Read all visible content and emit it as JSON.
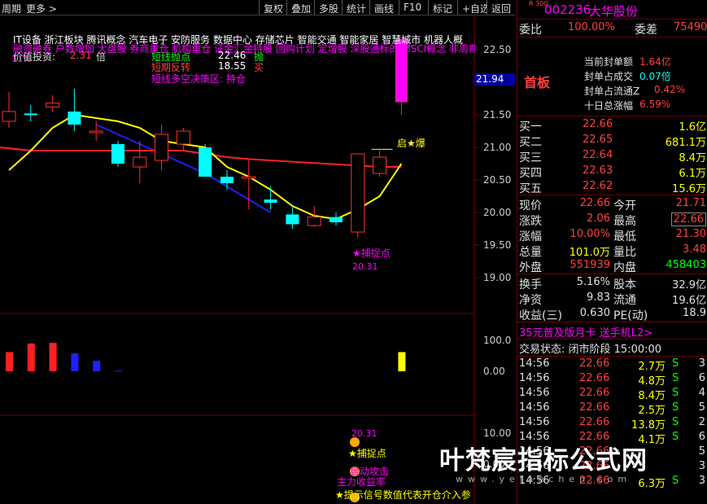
{
  "topbar": {
    "period_label": "周期",
    "more_label": "更多 >",
    "buttons": [
      "复权",
      "叠加",
      "多股",
      "统计",
      "画线",
      "F10",
      "标记",
      "+自选",
      "返回"
    ]
  },
  "chart": {
    "sectors_line1": "IT设备  浙江板块  腾讯概念 汽车电子 安防服务 数据中心 存储芯片 智能交通 智能家居 智慧城市 机器人概",
    "sectors_line2": "融资融券 户数增加 大盘股 券商重仓 机构重仓 证金汇金持股 回购计划 定增股 深股通标的 MSCI概念 非周期",
    "tag_11": "11%",
    "value_invest_label": "价值投资:",
    "value_invest_value": "2.31",
    "value_invest_unit": "倍",
    "indicators": [
      {
        "label": "短线抛点",
        "value": "22.46",
        "signal": "抛"
      },
      {
        "label": "短期反转",
        "value": "18.55",
        "signal": "买"
      },
      {
        "label": "短线多空决策区:",
        "value": "持仓",
        "signal": ""
      }
    ],
    "y_price": [
      "22.50",
      "22.00",
      "21.50",
      "21.00",
      "20.50",
      "20.00",
      "19.50",
      "19.00"
    ],
    "current_price_tag": "21.94",
    "qi_bao_label": "启★爆",
    "capture_label": "★捕捉点",
    "capture_value": "20.31",
    "y_vol": [
      "100.0",
      "0.00"
    ],
    "y_bottom": [
      "10.00",
      "0.00"
    ],
    "bottom_capture_value": "20.31",
    "bottom_capture_label": "捕捉点",
    "bottom_texts": [
      "启动攻击",
      "主力收益率",
      "★提示信号数值代表开仓介入参"
    ],
    "chart_data": {
      "type": "candlestick",
      "candles": [
        {
          "o": 21.4,
          "c": 21.55,
          "h": 21.85,
          "l": 21.3
        },
        {
          "o": 21.52,
          "c": 21.5,
          "h": 21.65,
          "l": 21.4
        },
        {
          "o": 21.62,
          "c": 21.68,
          "h": 21.8,
          "l": 21.55
        },
        {
          "o": 21.55,
          "c": 21.35,
          "h": 21.9,
          "l": 21.25
        },
        {
          "o": 21.25,
          "c": 21.25,
          "h": 21.4,
          "l": 21.1
        },
        {
          "o": 21.05,
          "c": 20.75,
          "h": 21.1,
          "l": 20.7
        },
        {
          "o": 20.7,
          "c": 20.85,
          "h": 21.1,
          "l": 20.45
        },
        {
          "o": 20.8,
          "c": 21.2,
          "h": 21.35,
          "l": 20.65
        },
        {
          "o": 21.05,
          "c": 21.25,
          "h": 21.3,
          "l": 20.95
        },
        {
          "o": 21.0,
          "c": 20.55,
          "h": 21.05,
          "l": 20.55
        },
        {
          "o": 20.55,
          "c": 20.45,
          "h": 20.65,
          "l": 20.35
        },
        {
          "o": 20.55,
          "c": 20.55,
          "h": 20.8,
          "l": 20.05
        },
        {
          "o": 20.2,
          "c": 20.15,
          "h": 20.4,
          "l": 20.05
        },
        {
          "o": 19.97,
          "c": 19.82,
          "h": 20.1,
          "l": 19.75
        },
        {
          "o": 19.8,
          "c": 19.93,
          "h": 20.1,
          "l": 19.78
        },
        {
          "o": 19.93,
          "c": 19.85,
          "h": 20.0,
          "l": 19.8
        },
        {
          "o": 19.7,
          "c": 20.9,
          "h": 20.9,
          "l": 19.62
        },
        {
          "o": 20.6,
          "c": 20.85,
          "h": 20.95,
          "l": 20.55
        },
        {
          "o": 21.7,
          "c": 22.66,
          "h": 22.66,
          "l": 21.5
        }
      ],
      "ma_yellow": [
        20.65,
        20.95,
        21.3,
        21.5,
        21.45,
        21.4,
        21.3,
        21.1,
        21.05,
        21.0,
        20.7,
        20.55,
        20.35,
        20.1,
        19.95,
        19.9,
        20.05,
        20.25,
        20.75
      ],
      "ma_blue_red": [
        21.0,
        20.95,
        20.95,
        20.95,
        20.95,
        20.95,
        20.95,
        20.95,
        20.95,
        20.9,
        20.85,
        20.82,
        20.8,
        20.78,
        20.76,
        20.74,
        20.72,
        20.7,
        20.7
      ],
      "vol_bars": [
        {
          "v": 62,
          "c": "red"
        },
        {
          "v": 90,
          "c": "red"
        },
        {
          "v": 92,
          "c": "red"
        },
        {
          "v": 58,
          "c": "blue"
        },
        {
          "v": 34,
          "c": "blue"
        },
        {
          "v": 2,
          "c": "blue"
        },
        {
          "v": 0,
          "c": "none"
        },
        {
          "v": 0,
          "c": "none"
        },
        {
          "v": 0,
          "c": "none"
        },
        {
          "v": 0,
          "c": "none"
        },
        {
          "v": 0,
          "c": "none"
        },
        {
          "v": 0,
          "c": "none"
        },
        {
          "v": 0,
          "c": "none"
        },
        {
          "v": 0,
          "c": "none"
        },
        {
          "v": 0,
          "c": "none"
        },
        {
          "v": 0,
          "c": "none"
        },
        {
          "v": 0,
          "c": "none"
        },
        {
          "v": 0,
          "c": "none"
        },
        {
          "v": 62,
          "c": "yellow"
        }
      ],
      "ylim_price": [
        18.75,
        22.75
      ]
    }
  },
  "right": {
    "code_prefix": "R 300",
    "code": "002236",
    "name": "大华股份",
    "weibi_label": "委比",
    "weibi_value": "100.00%",
    "weicha_label": "委差",
    "weicha_value": "75490",
    "limit_label": "首板",
    "limit_info": [
      {
        "label": "当前封单额",
        "value": "1.64亿"
      },
      {
        "label": "封单占成交",
        "value": "0.07倍"
      },
      {
        "label": "封单占流通Z",
        "value": "0.42%"
      },
      {
        "label": "十日总涨幅",
        "value": "6.59%"
      }
    ],
    "bids": [
      {
        "label": "买一",
        "price": "22.66",
        "vol": "1.6亿"
      },
      {
        "label": "买二",
        "price": "22.65",
        "vol": "681.1万"
      },
      {
        "label": "买三",
        "price": "22.64",
        "vol": "8.4万"
      },
      {
        "label": "买四",
        "price": "22.63",
        "vol": "6.1万"
      },
      {
        "label": "买五",
        "price": "22.62",
        "vol": "15.6万"
      }
    ],
    "stats": [
      {
        "l1": "现价",
        "v1": "22.66",
        "l2": "今开",
        "v2": "21.71"
      },
      {
        "l1": "涨跌",
        "v1": "2.06",
        "l2": "最高",
        "v2": "22.66"
      },
      {
        "l1": "涨幅",
        "v1": "10.00%",
        "l2": "最低",
        "v2": "21.30"
      },
      {
        "l1": "总量",
        "v1": "101.0万",
        "l2": "量比",
        "v2": "3.48"
      },
      {
        "l1": "外盘",
        "v1": "551939",
        "l2": "内盘",
        "v2": "458403"
      }
    ],
    "stats2": [
      {
        "l1": "换手",
        "v1": "5.16%",
        "l2": "股本",
        "v2": "32.9亿"
      },
      {
        "l1": "净资",
        "v1": "9.83",
        "l2": "流通",
        "v2": "19.6亿"
      },
      {
        "l1": "收益(三)",
        "v1": "0.630",
        "l2": "PE(动)",
        "v2": "18.9"
      }
    ],
    "promo": "35元普及版月卡 送手机L2>",
    "trade_status": "交易状态: 闭市阶段 15:00:00",
    "ticks": [
      {
        "t": "14:56",
        "p": "22.66",
        "v": "2.7万",
        "s": "S",
        "n": "3"
      },
      {
        "t": "14:56",
        "p": "22.66",
        "v": "4.8万",
        "s": "S",
        "n": "6"
      },
      {
        "t": "14:56",
        "p": "22.66",
        "v": "8.4万",
        "s": "S",
        "n": "4"
      },
      {
        "t": "14:56",
        "p": "22.66",
        "v": "2.5万",
        "s": "S",
        "n": "5"
      },
      {
        "t": "14:56",
        "p": "22.66",
        "v": "13.8万",
        "s": "S",
        "n": "2"
      },
      {
        "t": "14:56",
        "p": "22.66",
        "v": "4.1万",
        "s": "S",
        "n": "6"
      },
      {
        "t": "14:56",
        "p": "22.66",
        "v": "",
        "s": "",
        "n": "5"
      },
      {
        "t": "14:56",
        "p": "22.66",
        "v": "",
        "s": "",
        "n": "3"
      },
      {
        "t": "14:56",
        "p": "22.66",
        "v": "6.3万",
        "s": "S",
        "n": "3"
      }
    ]
  },
  "watermark": {
    "title": "叶梵宸指标公式网",
    "url": "www.yefanchen.com"
  }
}
